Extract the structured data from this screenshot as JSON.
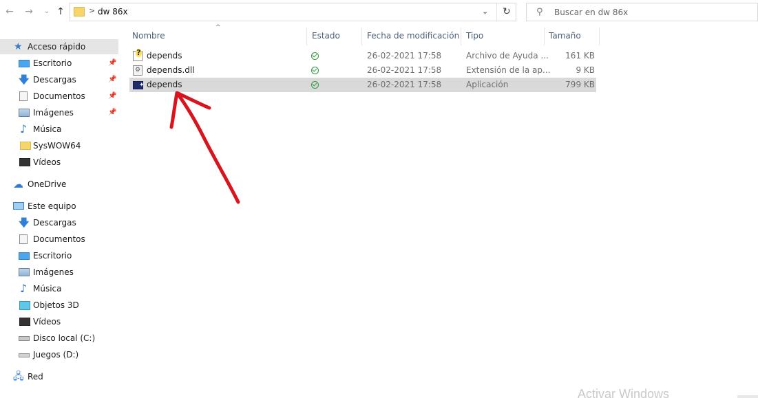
{
  "navigation": {
    "back_icon": "arrow-left-icon",
    "forward_icon": "arrow-right-icon",
    "recent_icon": "chevron-down-icon",
    "up_icon": "arrow-up-icon"
  },
  "address_bar": {
    "path": "dw 86x",
    "separator": ">"
  },
  "search": {
    "placeholder": "Buscar en dw 86x"
  },
  "sidebar": {
    "quick_access": "Acceso rápido",
    "quick_items": [
      {
        "label": "Escritorio",
        "icon": "desktop-icon",
        "pinned": true
      },
      {
        "label": "Descargas",
        "icon": "download-icon",
        "pinned": true
      },
      {
        "label": "Documentos",
        "icon": "document-icon",
        "pinned": true
      },
      {
        "label": "Imágenes",
        "icon": "picture-icon",
        "pinned": true
      },
      {
        "label": "Música",
        "icon": "music-icon",
        "pinned": false
      },
      {
        "label": "SysWOW64",
        "icon": "folder-icon",
        "pinned": false
      },
      {
        "label": "Vídeos",
        "icon": "video-icon",
        "pinned": false
      }
    ],
    "onedrive": "OneDrive",
    "this_pc": "Este equipo",
    "pc_items": [
      {
        "label": "Descargas",
        "icon": "download-icon"
      },
      {
        "label": "Documentos",
        "icon": "document-icon"
      },
      {
        "label": "Escritorio",
        "icon": "desktop-icon"
      },
      {
        "label": "Imágenes",
        "icon": "picture-icon"
      },
      {
        "label": "Música",
        "icon": "music-icon"
      },
      {
        "label": "Objetos 3D",
        "icon": "cube-icon"
      },
      {
        "label": "Vídeos",
        "icon": "video-icon"
      },
      {
        "label": "Disco local (C:)",
        "icon": "disk-icon"
      },
      {
        "label": "Juegos (D:)",
        "icon": "drive-icon"
      }
    ],
    "network": "Red"
  },
  "columns": {
    "name": "Nombre",
    "status": "Estado",
    "date": "Fecha de modificación",
    "type": "Tipo",
    "size": "Tamaño"
  },
  "files": [
    {
      "name": "depends",
      "icon": "help-file-icon",
      "status": "synced",
      "date": "26-02-2021 17:58",
      "type": "Archivo de Ayuda ...",
      "size": "161 KB",
      "selected": false
    },
    {
      "name": "depends.dll",
      "icon": "dll-file-icon",
      "status": "synced",
      "date": "26-02-2021 17:58",
      "type": "Extensión de la ap...",
      "size": "9 KB",
      "selected": false
    },
    {
      "name": "depends",
      "icon": "application-icon",
      "status": "synced",
      "date": "26-02-2021 17:58",
      "type": "Aplicación",
      "size": "799 KB",
      "selected": true
    }
  ],
  "annotation": {
    "arrow_color": "#d9141e"
  },
  "watermark": "Activar Windows"
}
